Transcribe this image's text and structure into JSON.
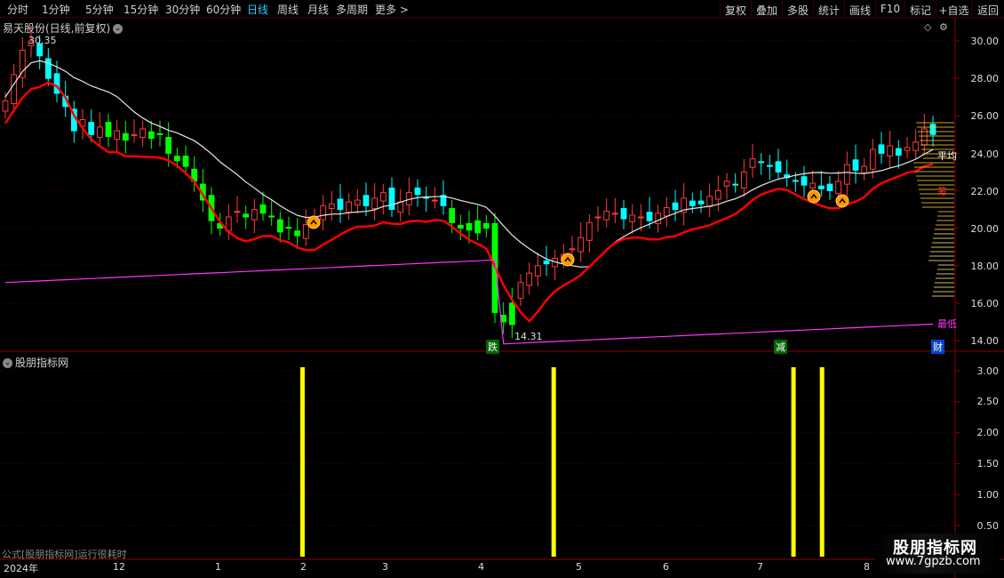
{
  "toolbar": {
    "period_tabs": [
      "分时",
      "1分钟",
      "5分钟",
      "15分钟",
      "30分钟",
      "60分钟",
      "日线",
      "周线",
      "月线",
      "多周期",
      "更多 >"
    ],
    "active_tab": "日线",
    "right_buttons": [
      "复权",
      "叠加",
      "多股",
      "统计",
      "画线",
      "F10",
      "标记",
      "+自选",
      "返回"
    ]
  },
  "main_chart": {
    "title": "易天股份(日线,前复权)",
    "y_ticks": [
      "30.00",
      "28.00",
      "26.00",
      "24.00",
      "22.00",
      "20.00",
      "18.00",
      "16.00",
      "14.00"
    ],
    "high_label": "30.35",
    "low_label": "14.31",
    "annotations": {
      "die": "跌",
      "jian": "减",
      "cai": "财",
      "zui": "最低",
      "ping": "平均",
      "zhi": "筹"
    }
  },
  "sub_chart": {
    "title": "股朋指标网",
    "y_ticks": [
      "3.00",
      "2.50",
      "2.00",
      "1.50",
      "1.00",
      "0.50"
    ]
  },
  "x_axis": {
    "labels": [
      "2024年",
      "12",
      "1",
      "2",
      "3",
      "4",
      "5",
      "6",
      "7",
      "8"
    ]
  },
  "formula_status": "公式[股朋指标网]运行很耗时",
  "watermark": {
    "title": "股朋指标网",
    "url": "www.7gpzb.com"
  },
  "colors": {
    "up": "#ff3b3b",
    "down": "#00ff00",
    "line_white": "#e8e8e8",
    "line_red": "#ff0000",
    "line_purple": "#ff33ff",
    "signal": "#ffff00",
    "active_tab": "#33ccff",
    "grid": "#3a0000"
  },
  "chart_data": [
    {
      "type": "candlestick",
      "title": "易天股份(日线,前复权)",
      "ylim": [
        14,
        31
      ],
      "x_labels": [
        "2024年",
        "12",
        "1",
        "2",
        "3",
        "4",
        "5",
        "6",
        "7",
        "8"
      ],
      "closes": [
        26.8,
        28.2,
        29.5,
        30.0,
        29.2,
        28.0,
        27.2,
        26.5,
        25.2,
        25.8,
        25.0,
        25.4,
        24.9,
        25.2,
        24.7,
        25.0,
        25.3,
        24.8,
        25.0,
        24.0,
        23.6,
        23.3,
        22.5,
        21.5,
        20.4,
        20.0,
        20.6,
        20.9,
        20.6,
        21.0,
        20.8,
        20.6,
        19.8,
        20.0,
        19.6,
        20.2,
        20.6,
        21.2,
        21.3,
        21.0,
        21.4,
        21.5,
        21.2,
        21.6,
        21.9,
        21.0,
        21.4,
        21.9,
        21.8,
        21.6,
        21.5,
        21.2,
        20.3,
        20.0,
        19.9,
        20.4,
        20.0,
        15.5,
        15.0,
        16.0,
        17.1,
        17.6,
        18.0,
        18.1,
        18.4,
        18.6,
        18.9,
        19.5,
        20.3,
        20.6,
        20.9,
        20.8,
        20.5,
        20.7,
        20.6,
        20.4,
        20.8,
        21.1,
        21.0,
        21.6,
        21.2,
        21.3,
        21.7,
        22.0,
        22.5,
        22.3,
        23.0,
        23.7,
        23.5,
        23.3,
        23.0,
        22.7,
        22.5,
        22.3,
        22.4,
        22.1,
        22.0,
        22.5,
        23.4,
        23.1,
        23.3,
        24.2,
        24.0,
        24.4,
        23.9,
        24.3,
        24.6,
        25.3,
        25.0
      ]
    },
    {
      "type": "bar",
      "title": "股朋指标网",
      "ylim": [
        0.4,
        3.2
      ],
      "signal_positions": [
        0.316,
        0.58,
        0.832,
        0.862
      ],
      "values": [
        3,
        3,
        3,
        3
      ]
    }
  ]
}
